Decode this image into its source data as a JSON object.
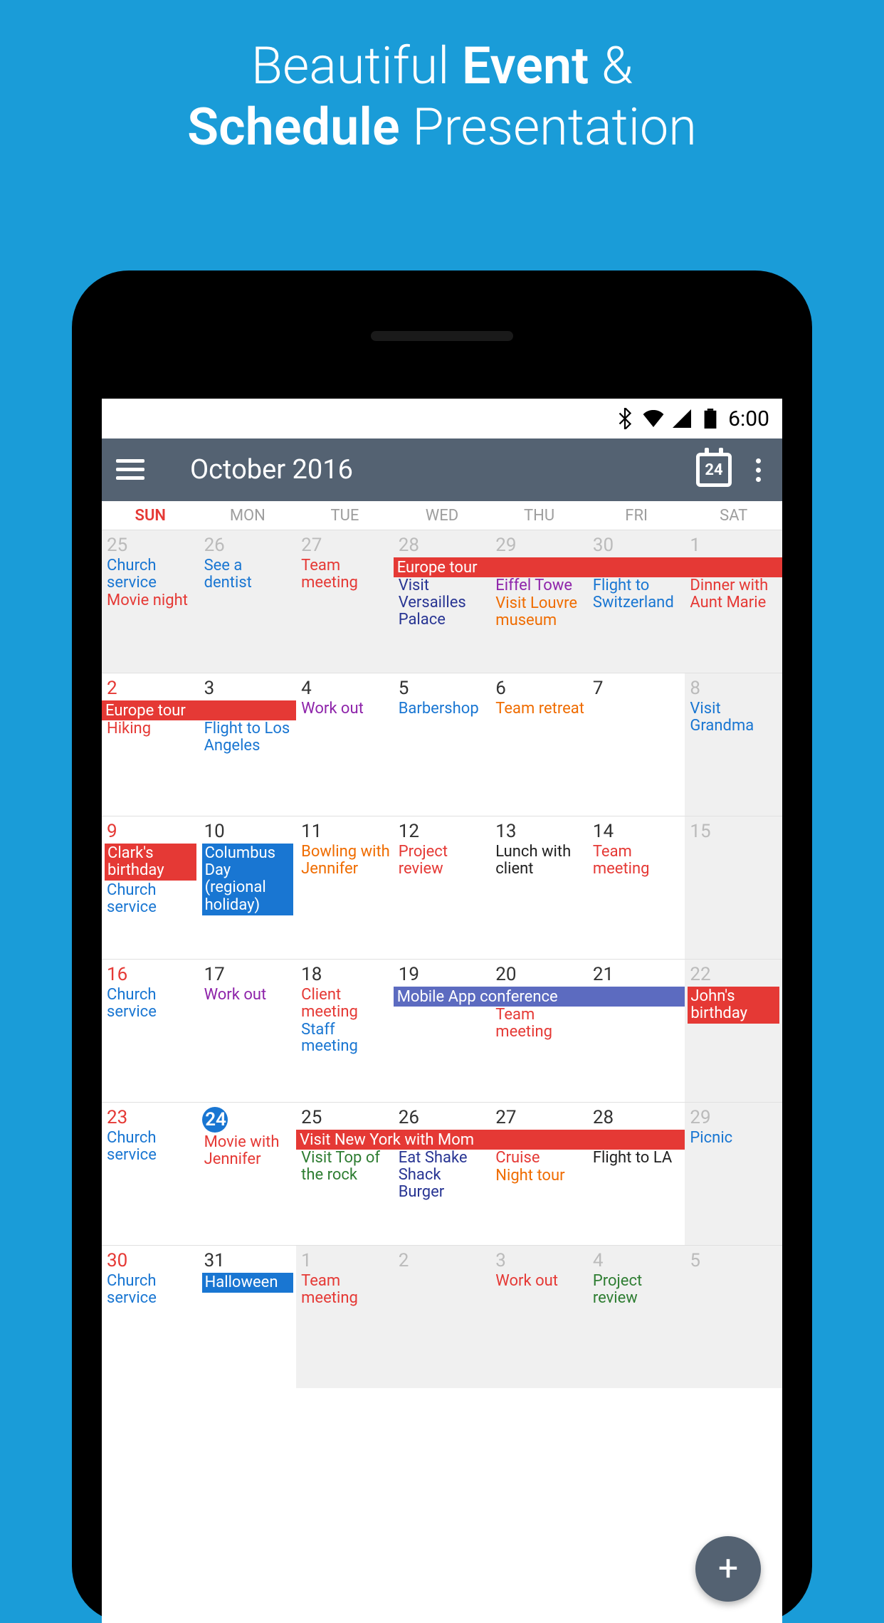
{
  "promo": {
    "l1a": "Beautiful ",
    "l1b": "Event",
    "l1c": " &",
    "l2a": "Schedule",
    "l2b": " Presentation"
  },
  "status": {
    "time": "6:00"
  },
  "appbar": {
    "title": "October 2016",
    "today": "24"
  },
  "days": [
    "SUN",
    "MON",
    "TUE",
    "WED",
    "THU",
    "FRI",
    "SAT"
  ],
  "weeks": [
    {
      "band1": {
        "text": "Europe tour",
        "start": 3,
        "end": 7,
        "cls": ""
      },
      "cells": [
        {
          "d": "25",
          "out": true,
          "sun": true,
          "ev": [
            {
              "t": "Church service",
              "c": "blue"
            },
            {
              "t": "Movie night",
              "c": "red"
            }
          ]
        },
        {
          "d": "26",
          "out": true,
          "ev": [
            {
              "t": "See a dentist",
              "c": "blue"
            }
          ]
        },
        {
          "d": "27",
          "out": true,
          "ev": [
            {
              "t": "Team meeting",
              "c": "red"
            }
          ]
        },
        {
          "d": "28",
          "out": true,
          "bandpad": 1,
          "ev": [
            {
              "t": "Visit Versailles Palace",
              "c": "darkblue"
            }
          ]
        },
        {
          "d": "29",
          "out": true,
          "bandpad": 1,
          "ev": [
            {
              "t": "Eiffel Towe",
              "c": "purple"
            },
            {
              "t": "Visit Louvre museum",
              "c": "orange"
            }
          ]
        },
        {
          "d": "30",
          "out": true,
          "bandpad": 1,
          "ev": [
            {
              "t": "Flight to Switzerland",
              "c": "blue"
            }
          ]
        },
        {
          "d": "1",
          "out": true,
          "bandpad": 1,
          "ev": [
            {
              "t": "Dinner with Aunt Marie",
              "c": "red"
            }
          ]
        }
      ]
    },
    {
      "band1": {
        "text": "Europe tour",
        "start": 0,
        "end": 2,
        "cls": ""
      },
      "cells": [
        {
          "d": "2",
          "sun": true,
          "bandpad": 1,
          "ev": [
            {
              "t": "Hiking",
              "c": "red"
            }
          ]
        },
        {
          "d": "3",
          "bandpad": 1,
          "ev": [
            {
              "t": "Flight to Los Angeles",
              "c": "blue"
            }
          ]
        },
        {
          "d": "4",
          "ev": [
            {
              "t": "Work out",
              "c": "purple"
            }
          ]
        },
        {
          "d": "5",
          "ev": [
            {
              "t": "Barbershop",
              "c": "blue"
            }
          ]
        },
        {
          "d": "6",
          "ev": [
            {
              "t": "Team retreat",
              "c": "orange"
            }
          ]
        },
        {
          "d": "7",
          "ev": []
        },
        {
          "d": "8",
          "out": true,
          "ev": [
            {
              "t": "Visit Grandma",
              "c": "blue"
            }
          ]
        }
      ]
    },
    {
      "cells": [
        {
          "d": "9",
          "sun": true,
          "badge": {
            "text": "Clark's birthday",
            "cls": ""
          },
          "ev": [
            {
              "t": "Church service",
              "c": "blue"
            }
          ]
        },
        {
          "d": "10",
          "badge": {
            "text": "Columbus Day (regional holiday)",
            "cls": "blue",
            "tall": true
          },
          "ev": []
        },
        {
          "d": "11",
          "ev": [
            {
              "t": "Bowling with Jennifer",
              "c": "orange"
            }
          ]
        },
        {
          "d": "12",
          "ev": [
            {
              "t": "Project review",
              "c": "red"
            }
          ]
        },
        {
          "d": "13",
          "ev": [
            {
              "t": "Lunch with client",
              "c": "black"
            }
          ]
        },
        {
          "d": "14",
          "ev": [
            {
              "t": "Team meeting",
              "c": "red"
            }
          ]
        },
        {
          "d": "15",
          "out": true,
          "ev": []
        }
      ]
    },
    {
      "band1": {
        "text": "Mobile App conference",
        "start": 3,
        "end": 6,
        "cls": "slate"
      },
      "cells": [
        {
          "d": "16",
          "sun": true,
          "ev": [
            {
              "t": "Church service",
              "c": "blue"
            }
          ]
        },
        {
          "d": "17",
          "ev": [
            {
              "t": "Work out",
              "c": "purple"
            }
          ]
        },
        {
          "d": "18",
          "ev": [
            {
              "t": "Client meeting",
              "c": "red"
            },
            {
              "t": "Staff meeting",
              "c": "blue"
            }
          ]
        },
        {
          "d": "19",
          "bandpad": 1,
          "ev": []
        },
        {
          "d": "20",
          "bandpad": 1,
          "ev": [
            {
              "t": "Team meeting",
              "c": "red"
            }
          ]
        },
        {
          "d": "21",
          "bandpad": 1,
          "ev": []
        },
        {
          "d": "22",
          "out": true,
          "badge": {
            "text": "John's birthday",
            "cls": ""
          },
          "ev": []
        }
      ]
    },
    {
      "band1": {
        "text": "Visit New York with Mom",
        "start": 2,
        "end": 6,
        "cls": ""
      },
      "cells": [
        {
          "d": "23",
          "sun": true,
          "ev": [
            {
              "t": "Church service",
              "c": "blue"
            }
          ]
        },
        {
          "d": "24",
          "today": true,
          "ev": [
            {
              "t": "Movie with Jennifer",
              "c": "red"
            }
          ]
        },
        {
          "d": "25",
          "bandpad": 1,
          "ev": [
            {
              "t": "Visit Top of the rock",
              "c": "green"
            }
          ]
        },
        {
          "d": "26",
          "bandpad": 1,
          "ev": [
            {
              "t": "Eat Shake Shack Burger",
              "c": "darkblue"
            }
          ]
        },
        {
          "d": "27",
          "bandpad": 1,
          "ev": [
            {
              "t": "Cruise",
              "c": "red"
            },
            {
              "t": "Night tour",
              "c": "orange"
            }
          ]
        },
        {
          "d": "28",
          "bandpad": 1,
          "ev": [
            {
              "t": "Flight to LA",
              "c": "black"
            }
          ]
        },
        {
          "d": "29",
          "out": true,
          "ev": [
            {
              "t": "Picnic",
              "c": "blue"
            }
          ]
        }
      ]
    },
    {
      "cells": [
        {
          "d": "30",
          "sun": true,
          "ev": [
            {
              "t": "Church service",
              "c": "blue"
            }
          ]
        },
        {
          "d": "31",
          "badge": {
            "text": "Halloween",
            "cls": "blue"
          },
          "ev": []
        },
        {
          "d": "1",
          "out": true,
          "ev": [
            {
              "t": "Team meeting",
              "c": "red"
            }
          ]
        },
        {
          "d": "2",
          "out": true,
          "ev": []
        },
        {
          "d": "3",
          "out": true,
          "ev": [
            {
              "t": "Work out",
              "c": "red"
            }
          ]
        },
        {
          "d": "4",
          "out": true,
          "ev": [
            {
              "t": "Project review",
              "c": "green"
            }
          ]
        },
        {
          "d": "5",
          "out": true,
          "ev": []
        }
      ]
    }
  ],
  "fab": "+"
}
